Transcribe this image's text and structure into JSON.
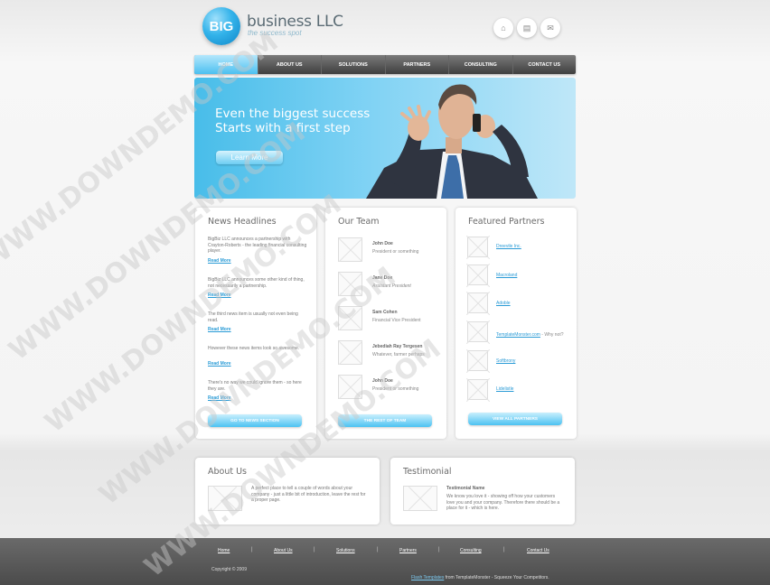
{
  "header": {
    "logo_mark": "BIG",
    "company": "business LLC",
    "tagline": "the success spot",
    "icons": [
      "home-icon",
      "print-icon",
      "mail-icon"
    ],
    "icon_glyphs": [
      "⌂",
      "▤",
      "✉"
    ]
  },
  "nav": [
    {
      "label": "Home",
      "active": true
    },
    {
      "label": "About Us"
    },
    {
      "label": "Solutions"
    },
    {
      "label": "Partners"
    },
    {
      "label": "Consulting"
    },
    {
      "label": "Contact Us"
    }
  ],
  "hero": {
    "line1": "Even the biggest success",
    "line2": "Starts with a first step",
    "button": "Learn More"
  },
  "news": {
    "title": "News Headlines",
    "items": [
      {
        "text": "BigBiz LLC announces a partnership with Crayton-Roberts - the leading financial consulting player.",
        "link": "Read More"
      },
      {
        "text": "BigBiz LLC announces some other kind of thing, not necessarily a partnership.",
        "link": "Read More"
      },
      {
        "text": "The third news item is usually not even being read.",
        "link": "Read More"
      },
      {
        "text": "However these news items look so awesome.",
        "link": "Read More"
      },
      {
        "text": "There's no way we could ignore them - so here they are.",
        "link": "Read More"
      }
    ],
    "button": "Go to news section"
  },
  "team": {
    "title": "Our Team",
    "members": [
      {
        "name": "John Doe",
        "role": "President or something"
      },
      {
        "name": "Jane Doe",
        "role": "Assistant President"
      },
      {
        "name": "Sam Cohen",
        "role": "Financial Vice President"
      },
      {
        "name": "Jebediah Ray Tergesen",
        "role": "Whatever, farmer perhaps"
      },
      {
        "name": "John Doe",
        "role": "President or something"
      }
    ],
    "button": "The rest of team"
  },
  "partners": {
    "title": "Featured Partners",
    "items": [
      {
        "name": "Dreevile Inc.",
        "extra": ""
      },
      {
        "name": "Macroland",
        "extra": ""
      },
      {
        "name": "Adoble",
        "extra": ""
      },
      {
        "name": "TemplateMonster.com",
        "extra": " - Why not?"
      },
      {
        "name": "Softbrony",
        "extra": ""
      },
      {
        "name": "Lidelistle",
        "extra": ""
      }
    ],
    "button": "View all partners"
  },
  "about": {
    "title": "About Us",
    "text": "A perfect place to tell a couple of words about your company - just a little bit of introduction, leave the rest for a proper page."
  },
  "testimonial": {
    "title": "Testimonial",
    "name": "Testimonial Name",
    "text": "We know you love it - showing off how your customers love you and your company. Therefore there should be a place for it - which is here."
  },
  "footer": {
    "links": [
      "Home",
      "About Us",
      "Solutions",
      "Partners",
      "Consulting",
      "Contact Us"
    ],
    "separator": "|",
    "copyright": "Copyright © 2009",
    "credit_link": "Flash Templates",
    "credit_text": " from TemplateMonster - Squeeze Your Competitors."
  },
  "watermark": "WWW.DOWNDEMO.COM",
  "colors": {
    "accent": "#3fb8ec",
    "nav_dark": "#4a4a4a",
    "link": "#2a9bd6",
    "footer": "#555555"
  }
}
